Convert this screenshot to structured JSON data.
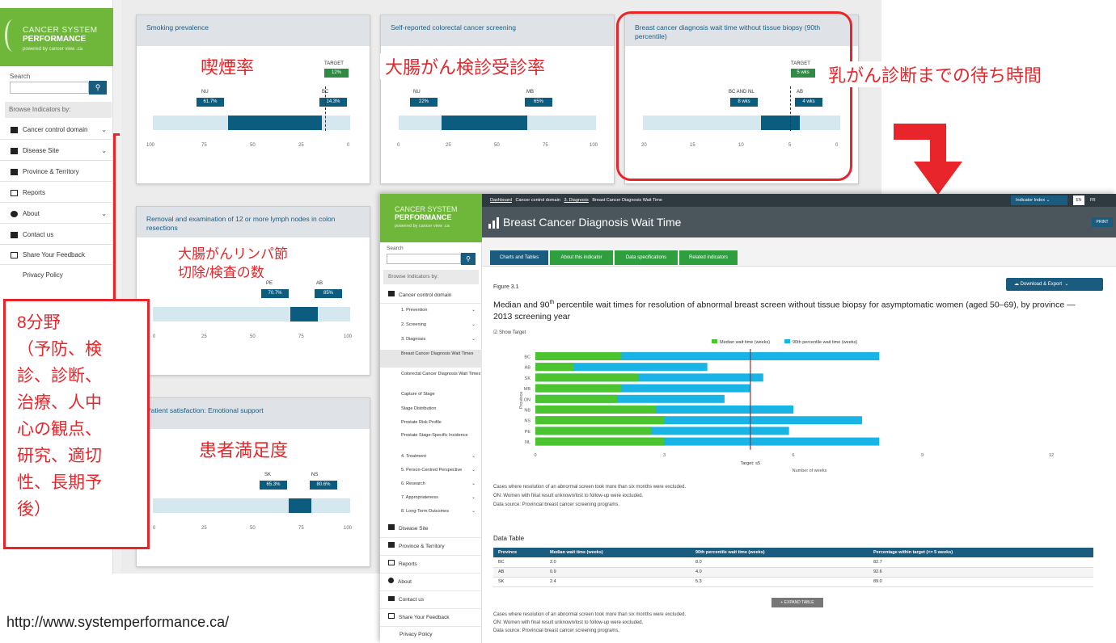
{
  "back": {
    "logo": {
      "line1": "CANCER SYSTEM",
      "line2": "PERFORMANCE",
      "line3": "powered by cancer view .ca"
    },
    "search_label": "Search",
    "search_icon": "search-icon",
    "browse_label": "Browse Indicators by:",
    "nav": [
      {
        "label": "Cancer control domain",
        "icon": "domain-icon"
      },
      {
        "label": "Disease Site",
        "icon": "disease-icon"
      },
      {
        "label": "Province & Territory",
        "icon": "map-icon"
      },
      {
        "label": "Reports",
        "icon": "report-icon"
      },
      {
        "label": "About",
        "icon": "info-icon"
      },
      {
        "label": "Contact us",
        "icon": "mail-icon"
      },
      {
        "label": "Share Your Feedback",
        "icon": "feedback-icon"
      },
      {
        "label": "Privacy Policy",
        "icon": ""
      }
    ],
    "cards": {
      "smoking": {
        "title": "Smoking prevalence",
        "flags": [
          {
            "label": "NU",
            "value": "61.7%"
          },
          {
            "label": "BC",
            "value": "14.3%"
          }
        ],
        "target_label": "TARGET",
        "target_value": "12%",
        "axis": [
          "100",
          "75",
          "50",
          "25",
          "0"
        ],
        "range": {
          "low": 14.3,
          "high": 61.7,
          "target": 12
        }
      },
      "screening": {
        "title": "Self-reported colorectal cancer screening",
        "flags": [
          {
            "label": "NU",
            "value": "22%"
          },
          {
            "label": "MB",
            "value": "65%"
          }
        ],
        "axis": [
          "0",
          "25",
          "50",
          "75",
          "100"
        ],
        "range": {
          "low": 22,
          "high": 65
        }
      },
      "breast": {
        "title": "Breast cancer diagnosis wait time without tissue biopsy (90th percentile)",
        "flags": [
          {
            "label": "BC AND NL",
            "value": "8 wks"
          },
          {
            "label": "AB",
            "value": "4 wks"
          }
        ],
        "target_label": "TARGET",
        "target_value": "5 wks",
        "axis": [
          "20",
          "15",
          "10",
          "5",
          "0"
        ],
        "range": {
          "low": 4,
          "high": 8,
          "target": 5
        }
      },
      "lymph": {
        "title": "Removal and examination of 12 or more lymph nodes in colon resections",
        "flags": [
          {
            "label": "PE",
            "value": "70.7%"
          },
          {
            "label": "AB",
            "value": "85%"
          }
        ],
        "axis": [
          "0",
          "25",
          "50",
          "75",
          "100"
        ],
        "range": {
          "low": 70.7,
          "high": 85
        }
      },
      "satisfaction": {
        "title": "Patient satisfaction: Emotional support",
        "flags": [
          {
            "label": "SK",
            "value": "65.3%"
          },
          {
            "label": "NS",
            "value": "80.6%"
          }
        ],
        "axis": [
          "0",
          "25",
          "50",
          "75",
          "100"
        ],
        "range": {
          "low": 65.3,
          "high": 80.6
        }
      }
    }
  },
  "annotations": {
    "smoking": "喫煙率",
    "screening": "大腸がん検診受診率",
    "breast": "乳がん診断までの待ち時間",
    "lymph_line1": "大腸がんリンパ節",
    "lymph_line2": "切除/検査の数",
    "satisfaction": "患者満足度",
    "domains": [
      "8分野",
      "（予防、検",
      "診、診断、",
      "治療、人中",
      "心の観点、",
      "研究、適切",
      "性、長期予",
      "後）"
    ],
    "url": "http://www.systemperformance.ca/"
  },
  "front": {
    "logo": {
      "line1": "CANCER SYSTEM",
      "line2": "PERFORMANCE",
      "line3": "powered by cancer view .ca"
    },
    "search_label": "Search",
    "browse_label": "Browse Indicators by:",
    "nav_top": "Cancer control domain",
    "domains": [
      {
        "label": "1. Prevention"
      },
      {
        "label": "2. Screening"
      },
      {
        "label": "3. Diagnosis"
      }
    ],
    "diagnosis_items": [
      "Breast Cancer Diagnosis Wait Times",
      "Colorectal Cancer Diagnosis Wait Times",
      "Capture of Stage",
      "Stage Distribution",
      "Prostate Risk Profile",
      "Prostate Stage-Specific Incidence"
    ],
    "domains_after": [
      "4. Treatment",
      "5. Person-Centred Perspective",
      "6. Research",
      "7. Appropriateness",
      "8. Long-Term Outcomes"
    ],
    "nav_bottom": [
      "Disease Site",
      "Province & Territory",
      "Reports",
      "About",
      "Contact us",
      "Share Your Feedback",
      "Privacy Policy"
    ],
    "breadcrumb": [
      "Dashboard",
      "Cancer control domain",
      "3. Diagnosis",
      "Breast Cancer Diagnosis Wait Time"
    ],
    "indicator_index": "Indicator Index",
    "lang_en": "EN",
    "lang_fr": "FR",
    "page_title": "Breast Cancer Diagnosis Wait Time",
    "print": "PRINT",
    "tabs": [
      "Charts and Tables",
      "About this indicator",
      "Data specifications",
      "Related indicators"
    ],
    "figure_label": "Figure 3.1",
    "download": "Download & Export",
    "figure_title_a": "Median and 90",
    "figure_title_sup": "th",
    "figure_title_b": " percentile wait times for resolution of abnormal breast screen without tissue biopsy for asymptomatic women (aged 50–69), by province — 2013 screening year",
    "show_target": "Show Target",
    "target_label": "Target: ≤5",
    "notes": [
      "Cases where resolution of an abnormal screen took more than six months were excluded.",
      "ON: Women with final result unknown/lost to follow-up were excluded.",
      "Data source: Provincial breast cancer screening programs."
    ],
    "data_table_title": "Data Table",
    "table_headers": [
      "Province",
      "Median wait time (weeks)",
      "90th percentile wait time (weeks)",
      "Percentage within target (<= 5 weeks)"
    ],
    "table_rows": [
      [
        "BC",
        "2.0",
        "8.0",
        "82.7"
      ],
      [
        "AB",
        "0.9",
        "4.0",
        "92.6"
      ],
      [
        "SK",
        "2.4",
        "5.3",
        "89.0"
      ]
    ],
    "expand_table": "EXPAND TABLE"
  },
  "chart_data": {
    "type": "bar",
    "orientation": "horizontal",
    "stacked": false,
    "categories": [
      "BC",
      "AB",
      "SK",
      "MB",
      "ON",
      "NB",
      "NS",
      "PE",
      "NL"
    ],
    "series": [
      {
        "name": "Median wait time (weeks)",
        "color": "#4cc430",
        "values": [
          2.0,
          0.9,
          2.4,
          2.0,
          1.9,
          2.8,
          3.0,
          2.7,
          3.0
        ]
      },
      {
        "name": "90th percentile wait time (weeks)",
        "color": "#18b4e6",
        "values": [
          8.0,
          4.0,
          5.3,
          5.0,
          4.4,
          6.0,
          7.6,
          5.9,
          8.0
        ]
      }
    ],
    "target": 5,
    "xlabel": "Number of weeks",
    "ylabel": "Province",
    "xlim": [
      0,
      12
    ],
    "xticks": [
      0,
      3,
      6,
      9,
      12
    ],
    "legend": "top"
  }
}
